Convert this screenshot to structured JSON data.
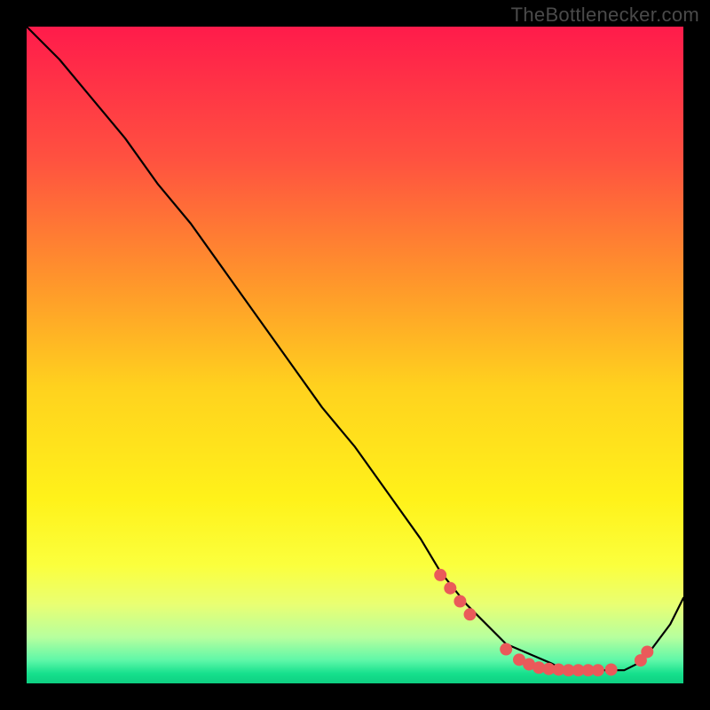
{
  "attribution": "TheBottlenecker.com",
  "chart_data": {
    "type": "line",
    "title": "",
    "xlabel": "",
    "ylabel": "",
    "xlim": [
      0,
      100
    ],
    "ylim": [
      0,
      100
    ],
    "series": [
      {
        "name": "curve",
        "x": [
          0,
          5,
          10,
          15,
          20,
          25,
          30,
          35,
          40,
          45,
          50,
          55,
          60,
          63,
          67,
          73,
          80,
          82,
          85,
          88,
          91,
          93,
          95,
          98,
          100
        ],
        "y": [
          100,
          95,
          89,
          83,
          76,
          70,
          63,
          56,
          49,
          42,
          36,
          29,
          22,
          17,
          12,
          6,
          3,
          2,
          2,
          2,
          2,
          3,
          5,
          9,
          13
        ]
      }
    ],
    "markers": {
      "name": "highlight-dots",
      "color": "#ea5a5a",
      "points": [
        {
          "x": 63,
          "y": 16.5
        },
        {
          "x": 64.5,
          "y": 14.5
        },
        {
          "x": 66,
          "y": 12.5
        },
        {
          "x": 67.5,
          "y": 10.5
        },
        {
          "x": 73,
          "y": 5.2
        },
        {
          "x": 75,
          "y": 3.6
        },
        {
          "x": 76.5,
          "y": 2.9
        },
        {
          "x": 78,
          "y": 2.4
        },
        {
          "x": 79.5,
          "y": 2.2
        },
        {
          "x": 81,
          "y": 2.1
        },
        {
          "x": 82.5,
          "y": 2.0
        },
        {
          "x": 84,
          "y": 2.0
        },
        {
          "x": 85.5,
          "y": 2.0
        },
        {
          "x": 87,
          "y": 2.0
        },
        {
          "x": 89,
          "y": 2.1
        },
        {
          "x": 93.5,
          "y": 3.5
        },
        {
          "x": 94.5,
          "y": 4.8
        }
      ]
    },
    "background_gradient": {
      "stops": [
        {
          "offset": 0.0,
          "color": "#ff1b4b"
        },
        {
          "offset": 0.2,
          "color": "#ff5140"
        },
        {
          "offset": 0.4,
          "color": "#ff9a2a"
        },
        {
          "offset": 0.55,
          "color": "#ffd21e"
        },
        {
          "offset": 0.72,
          "color": "#fff21a"
        },
        {
          "offset": 0.82,
          "color": "#fbff3d"
        },
        {
          "offset": 0.88,
          "color": "#e9ff73"
        },
        {
          "offset": 0.93,
          "color": "#b6ff9e"
        },
        {
          "offset": 0.965,
          "color": "#5ef7a8"
        },
        {
          "offset": 0.985,
          "color": "#16e08d"
        },
        {
          "offset": 1.0,
          "color": "#0ecf82"
        }
      ]
    }
  }
}
